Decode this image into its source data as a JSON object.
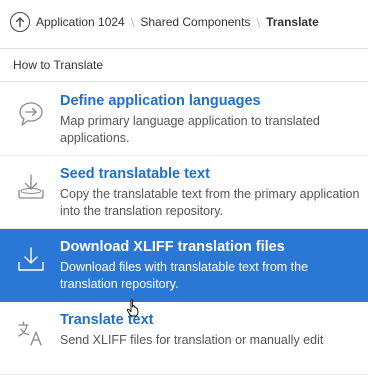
{
  "breadcrumb": {
    "items": [
      "Application 1024",
      "Shared Components"
    ],
    "current": "Translate",
    "separator": "\\"
  },
  "region": {
    "title": "How to Translate"
  },
  "steps": [
    {
      "title": "Define application languages",
      "description": "Map primary language application to translated applications.",
      "icon": "chat-bubble-arrow-icon"
    },
    {
      "title": "Seed translatable text",
      "description": "Copy the translatable text from the primary application into the translation repository.",
      "icon": "seed-tray-icon"
    },
    {
      "title": "Download XLIFF translation files",
      "description": "Download files with translatable text from the translation repository.",
      "icon": "download-tray-icon"
    },
    {
      "title": "Translate text",
      "description": "Send XLIFF files for translation or manually edit",
      "icon": "translate-icon"
    }
  ],
  "colors": {
    "accent": "#2a77d5",
    "link": "#1f6fd0"
  }
}
